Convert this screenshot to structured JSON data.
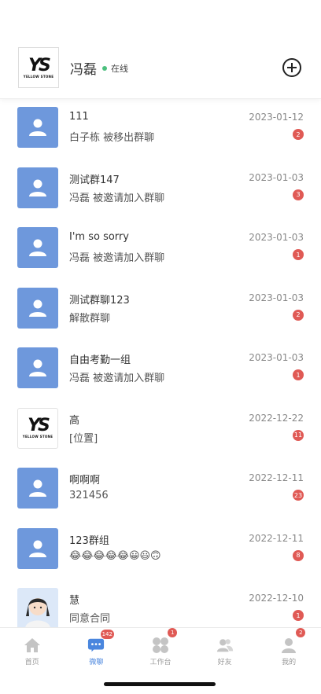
{
  "header": {
    "logo_mark": "YS",
    "logo_text": "YELLOW STONE",
    "username": "冯磊",
    "status": "在线",
    "status_color": "#4cc07e"
  },
  "chats": [
    {
      "name": "111",
      "message": "白子栋  被移出群聊",
      "date": "2023-01-12",
      "badge": "2",
      "avatar": "default"
    },
    {
      "name": "测试群147",
      "message": "冯磊  被邀请加入群聊",
      "date": "2023-01-03",
      "badge": "3",
      "avatar": "default"
    },
    {
      "name": "I'm so sorry",
      "message": "冯磊  被邀请加入群聊",
      "date": "2023-01-03",
      "badge": "1",
      "avatar": "default"
    },
    {
      "name": "测试群聊123",
      "message": "解散群聊",
      "date": "2023-01-03",
      "badge": "2",
      "avatar": "default"
    },
    {
      "name": "自由考勤一组",
      "message": "冯磊  被邀请加入群聊",
      "date": "2023-01-03",
      "badge": "1",
      "avatar": "default"
    },
    {
      "name": "高",
      "message": "[位置]",
      "date": "2022-12-22",
      "badge": "11",
      "avatar": "logo"
    },
    {
      "name": "啊啊啊",
      "message": "321456",
      "date": "2022-12-11",
      "badge": "23",
      "avatar": "default"
    },
    {
      "name": "123群组",
      "message": "😂😂😂😂😂😀😃🙃",
      "date": "2022-12-11",
      "badge": "8",
      "avatar": "default"
    },
    {
      "name": "慧",
      "message": "同意合同",
      "date": "2022-12-10",
      "badge": "1",
      "avatar": "girl"
    }
  ],
  "tabs": [
    {
      "label": "首页",
      "icon": "home-icon",
      "badge": ""
    },
    {
      "label": "微聊",
      "icon": "chat-icon",
      "badge": "142"
    },
    {
      "label": "工作台",
      "icon": "workbench-icon",
      "badge": "1"
    },
    {
      "label": "好友",
      "icon": "friends-icon",
      "badge": ""
    },
    {
      "label": "我的",
      "icon": "profile-icon",
      "badge": "2"
    }
  ],
  "colors": {
    "accent": "#4a86de",
    "avatar_bg": "#6e98dc",
    "badge": "#e05a55",
    "tab_inactive": "#c4c4c4"
  }
}
